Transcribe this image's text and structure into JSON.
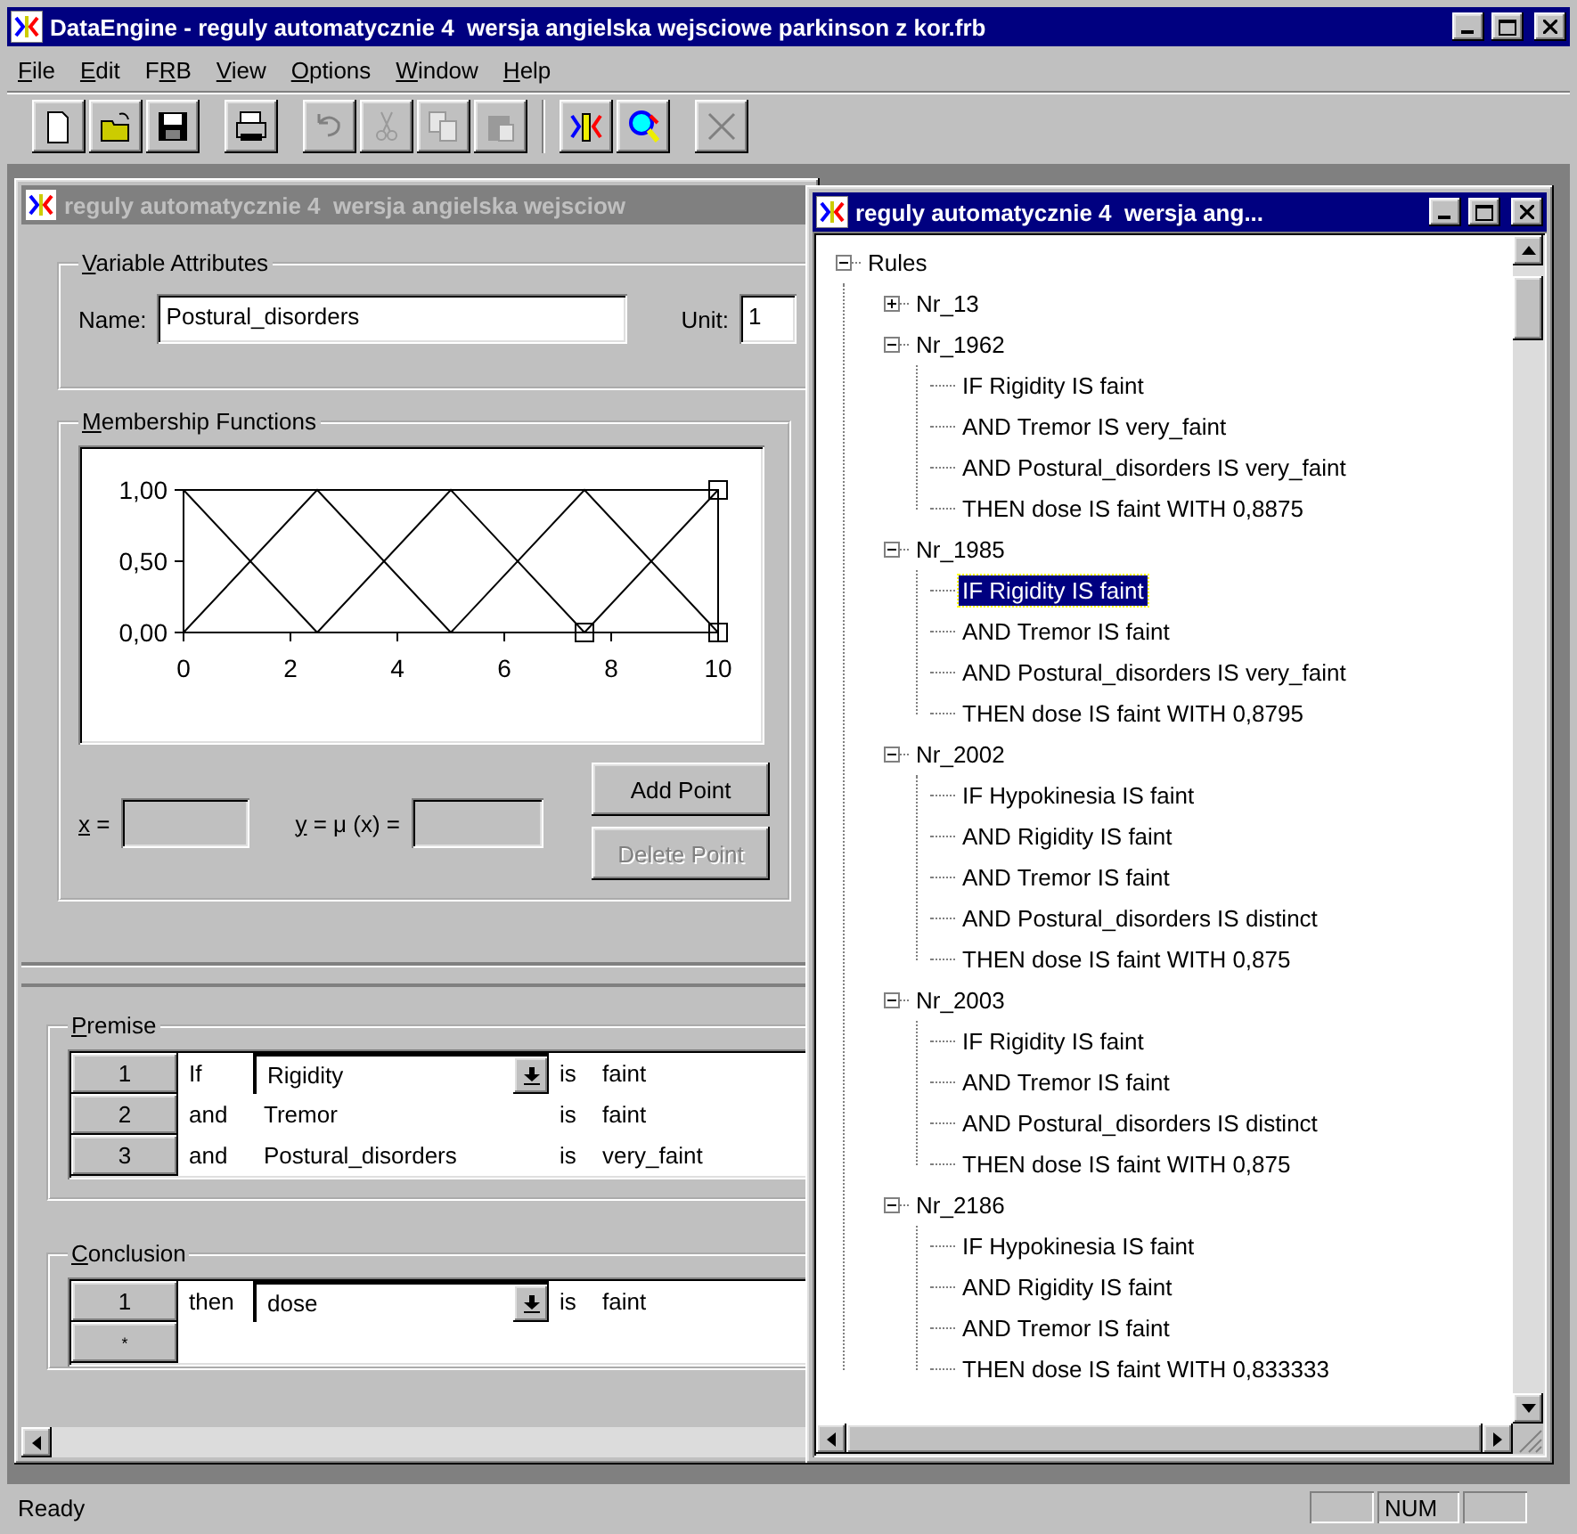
{
  "app": {
    "title": "DataEngine - reguly automatycznie 4  wersja angielska wejsciowe parkinson z kor.frb"
  },
  "menu": [
    {
      "key": "F",
      "post": "ile"
    },
    {
      "key": "E",
      "post": "dit"
    },
    {
      "pre": "F",
      "key": "R",
      "post": "B"
    },
    {
      "key": "V",
      "post": "iew"
    },
    {
      "key": "O",
      "post": "ptions"
    },
    {
      "key": "W",
      "post": "indow"
    },
    {
      "key": "H",
      "post": "elp"
    }
  ],
  "toolbar": [
    {
      "kind": "group",
      "buttons": [
        {
          "kind": "new",
          "disabled": false
        },
        {
          "kind": "open",
          "disabled": false
        },
        {
          "kind": "save",
          "disabled": false
        }
      ]
    },
    {
      "kind": "group",
      "buttons": [
        {
          "kind": "print",
          "disabled": false
        }
      ]
    },
    {
      "kind": "group",
      "buttons": [
        {
          "kind": "undo",
          "disabled": true
        },
        {
          "kind": "cut",
          "disabled": true
        },
        {
          "kind": "copy",
          "disabled": true
        },
        {
          "kind": "paste",
          "disabled": true
        }
      ]
    },
    {
      "kind": "separator"
    },
    {
      "kind": "group",
      "buttons": [
        {
          "kind": "rules",
          "disabled": false
        },
        {
          "kind": "inspect",
          "disabled": false
        }
      ]
    },
    {
      "kind": "group",
      "buttons": [
        {
          "kind": "delete",
          "disabled": true
        }
      ]
    }
  ],
  "variable_window": {
    "title": "reguly automatycznie 4  wersja angielska wejsciow",
    "attributes": {
      "legend": {
        "key": "V",
        "post": "ariable Attributes"
      },
      "name_label": "Name:",
      "name_value": "Postural_disorders",
      "unit_label": "Unit:",
      "unit_value": "1"
    },
    "membership": {
      "legend": {
        "key": "M",
        "post": "embership Functions"
      },
      "chart_data": {
        "type": "line",
        "x": [
          0,
          2.5,
          5,
          7.5,
          10
        ],
        "xlim": [
          0,
          10
        ],
        "ylim": [
          0,
          1
        ],
        "xticks": [
          0,
          2,
          4,
          6,
          8,
          10
        ],
        "yticks": [
          {
            "value": 0,
            "label": "0,00"
          },
          {
            "value": 0.5,
            "label": "0,50"
          },
          {
            "value": 1,
            "label": "1,00"
          }
        ],
        "series": [
          {
            "color": "#000000",
            "values": [
              1,
              0,
              null,
              null,
              null
            ]
          },
          {
            "color": "#000000",
            "values": [
              0,
              1,
              0,
              null,
              null
            ]
          },
          {
            "color": "#000000",
            "values": [
              null,
              0,
              1,
              0,
              null
            ]
          },
          {
            "color": "#000000",
            "values": [
              null,
              null,
              0,
              1,
              0
            ]
          },
          {
            "color": "#000000",
            "values": [
              null,
              null,
              null,
              0,
              1
            ]
          }
        ]
      },
      "functions": [
        {
          "selected": false
        },
        {
          "selected": false
        },
        {
          "selected": false
        },
        {
          "selected": false
        },
        {
          "selected": true
        }
      ],
      "x_label": {
        "key": "x",
        "post": " ="
      },
      "y_label": {
        "key": "y",
        "post": " = μ (x) ="
      },
      "buttons": [
        {
          "label": "Add Point",
          "disabled": false
        },
        {
          "label": "Delete Point",
          "disabled": true
        }
      ]
    },
    "premise": {
      "legend": {
        "key": "P",
        "post": "remise"
      },
      "rows": [
        {
          "kind": "rule",
          "index": "1",
          "conjunction": "If",
          "variable": "Rigidity",
          "verb": "is",
          "term": "faint",
          "editing": true
        },
        {
          "kind": "rule",
          "index": "2",
          "conjunction": "and",
          "variable": "Tremor",
          "verb": "is",
          "term": "faint",
          "editing": false
        },
        {
          "kind": "rule",
          "index": "3",
          "conjunction": "and",
          "variable": "Postural_disorders",
          "verb": "is",
          "term": "very_faint",
          "editing": false
        }
      ]
    },
    "conclusion": {
      "legend": {
        "key": "C",
        "post": "onclusion"
      },
      "rows": [
        {
          "kind": "rule",
          "index": "1",
          "conjunction": "then",
          "variable": "dose",
          "verb": "is",
          "term": "faint",
          "editing": true
        },
        {
          "kind": "new",
          "index": "*"
        }
      ]
    }
  },
  "rules_window": {
    "title": "reguly automatycznie 4  wersja ang...",
    "tree": [
      {
        "label": "Rules",
        "expanded": true,
        "selected": false,
        "children": [
          {
            "label": "Nr_13",
            "expanded": false,
            "selected": false
          },
          {
            "label": "Nr_1962",
            "expanded": true,
            "selected": false,
            "children": [
              {
                "label": "IF Rigidity IS faint",
                "selected": false
              },
              {
                "label": "AND Tremor IS very_faint",
                "selected": false
              },
              {
                "label": "AND Postural_disorders IS very_faint",
                "selected": false
              },
              {
                "label": "THEN dose IS faint WITH 0,8875",
                "selected": false
              }
            ]
          },
          {
            "label": "Nr_1985",
            "expanded": true,
            "selected": false,
            "children": [
              {
                "label": "IF Rigidity IS faint",
                "selected": true
              },
              {
                "label": "AND Tremor IS faint",
                "selected": false
              },
              {
                "label": "AND Postural_disorders IS very_faint",
                "selected": false
              },
              {
                "label": "THEN dose IS faint WITH 0,8795",
                "selected": false
              }
            ]
          },
          {
            "label": "Nr_2002",
            "expanded": true,
            "selected": false,
            "children": [
              {
                "label": "IF Hypokinesia IS faint",
                "selected": false
              },
              {
                "label": "AND Rigidity IS faint",
                "selected": false
              },
              {
                "label": "AND Tremor IS faint",
                "selected": false
              },
              {
                "label": "AND Postural_disorders IS distinct",
                "selected": false
              },
              {
                "label": "THEN dose IS faint WITH 0,875",
                "selected": false
              }
            ]
          },
          {
            "label": "Nr_2003",
            "expanded": true,
            "selected": false,
            "children": [
              {
                "label": "IF Rigidity IS faint",
                "selected": false
              },
              {
                "label": "AND Tremor IS faint",
                "selected": false
              },
              {
                "label": "AND Postural_disorders IS distinct",
                "selected": false
              },
              {
                "label": "THEN dose IS faint WITH 0,875",
                "selected": false
              }
            ]
          },
          {
            "label": "Nr_2186",
            "expanded": true,
            "selected": false,
            "children": [
              {
                "label": "IF Hypokinesia IS faint",
                "selected": false
              },
              {
                "label": "AND Rigidity IS faint",
                "selected": false
              },
              {
                "label": "AND Tremor IS faint",
                "selected": false
              },
              {
                "label": "THEN dose IS faint WITH 0,833333",
                "selected": false
              }
            ]
          }
        ]
      }
    ]
  },
  "status_bar": {
    "text": "Ready",
    "panels": [
      {
        "kind": "empty"
      },
      {
        "kind": "text",
        "label": "NUM"
      },
      {
        "kind": "empty"
      }
    ]
  }
}
